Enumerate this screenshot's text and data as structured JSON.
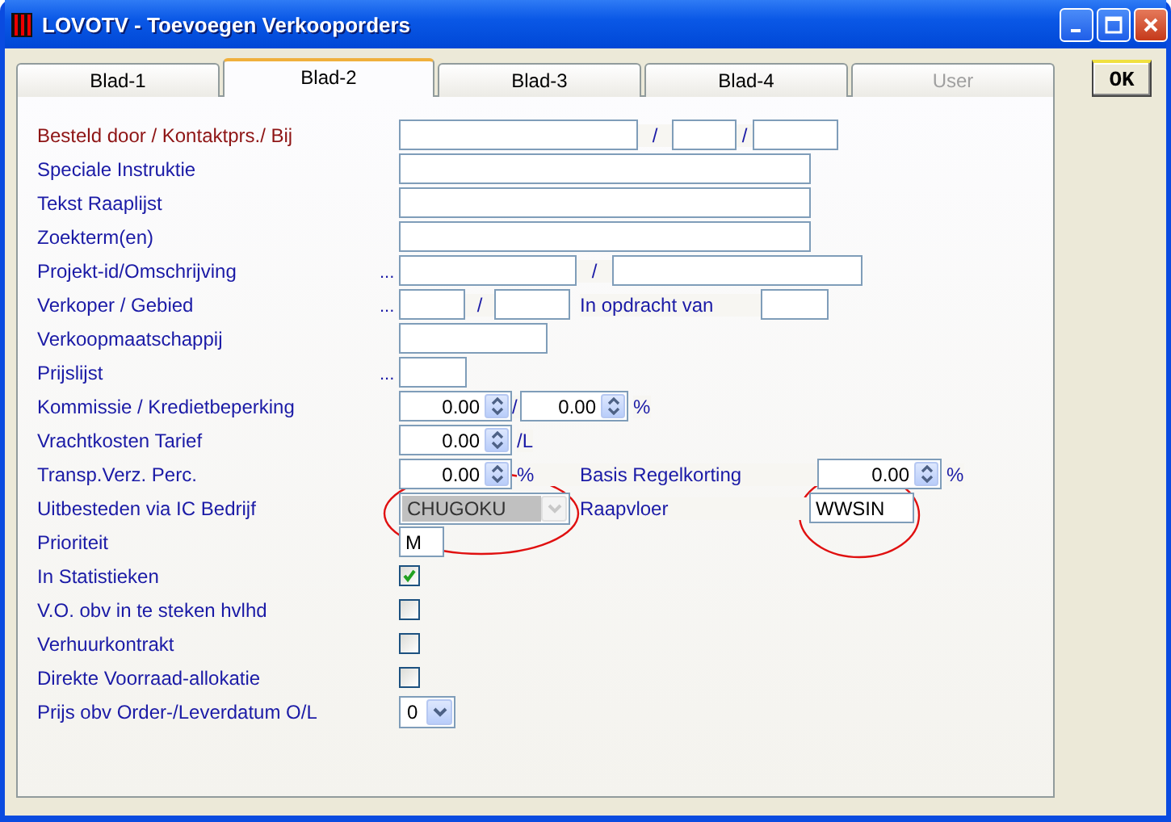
{
  "window": {
    "title": "LOVOTV - Toevoegen Verkooporders"
  },
  "tabs": [
    {
      "label": "Blad-1",
      "selected": false,
      "disabled": false
    },
    {
      "label": "Blad-2",
      "selected": true,
      "disabled": false
    },
    {
      "label": "Blad-3",
      "selected": false,
      "disabled": false
    },
    {
      "label": "Blad-4",
      "selected": false,
      "disabled": false
    },
    {
      "label": "User",
      "selected": false,
      "disabled": true
    }
  ],
  "ok_button": {
    "label": "OK"
  },
  "rows": [
    {
      "label": "Besteld door / Kontaktprs./ Bij",
      "required": true,
      "parts": [
        {
          "kind": "input"
        },
        {
          "kind": "text",
          "text": "/"
        },
        {
          "kind": "input"
        },
        {
          "kind": "text",
          "text": "/"
        },
        {
          "kind": "input"
        }
      ]
    },
    {
      "label": "Speciale Instruktie",
      "required": false,
      "parts": [
        {
          "kind": "input"
        }
      ]
    },
    {
      "label": "Tekst Raaplijst",
      "required": false,
      "parts": [
        {
          "kind": "input"
        }
      ]
    },
    {
      "label": "Zoekterm(en)",
      "required": false,
      "parts": [
        {
          "kind": "input"
        }
      ]
    },
    {
      "label": "Projekt-id/Omschrijving",
      "required": false,
      "lookup": "...",
      "parts": [
        {
          "kind": "input"
        },
        {
          "kind": "text",
          "text": "/"
        },
        {
          "kind": "input"
        }
      ]
    },
    {
      "label": "Verkoper / Gebied",
      "required": false,
      "lookup": "...",
      "parts": [
        {
          "kind": "input"
        },
        {
          "kind": "text",
          "text": "/"
        },
        {
          "kind": "input"
        },
        {
          "kind": "label",
          "text": "In opdracht van"
        },
        {
          "kind": "input"
        }
      ]
    },
    {
      "label": "Verkoopmaatschappij",
      "required": false,
      "parts": [
        {
          "kind": "input"
        }
      ]
    },
    {
      "label": "Prijslijst",
      "required": false,
      "lookup": "...",
      "parts": [
        {
          "kind": "input"
        }
      ]
    },
    {
      "label": "Kommissie / Kredietbeperking",
      "required": false,
      "parts": [
        {
          "kind": "spin",
          "value": "0.00"
        },
        {
          "kind": "text",
          "text": "/"
        },
        {
          "kind": "spin",
          "value": "0.00"
        },
        {
          "kind": "text",
          "text": "%"
        }
      ]
    },
    {
      "label": "Vrachtkosten Tarief",
      "required": false,
      "parts": [
        {
          "kind": "spin",
          "value": "0.00"
        },
        {
          "kind": "text",
          "text": "/L"
        }
      ]
    },
    {
      "label": "Transp.Verz. Perc.",
      "required": false,
      "parts": [
        {
          "kind": "spin",
          "value": "0.00"
        },
        {
          "kind": "text",
          "text": "%"
        },
        {
          "kind": "label",
          "text": "Basis Regelkorting"
        },
        {
          "kind": "spin",
          "value": "0.00"
        },
        {
          "kind": "text",
          "text": "%"
        }
      ]
    },
    {
      "label": "Uitbesteden via IC Bedrijf",
      "required": false,
      "parts": [
        {
          "kind": "select",
          "value": "CHUGOKU",
          "disabled": true
        },
        {
          "kind": "label",
          "text": "Raapvloer"
        },
        {
          "kind": "input",
          "value": "WWSIN"
        }
      ]
    },
    {
      "label": "Prioriteit",
      "required": false,
      "parts": [
        {
          "kind": "input",
          "value": "M"
        }
      ]
    },
    {
      "label": "In Statistieken",
      "required": false,
      "parts": [
        {
          "kind": "checkbox",
          "checked": true
        }
      ]
    },
    {
      "label": "V.O. obv in te steken hvlhd",
      "required": false,
      "parts": [
        {
          "kind": "checkbox",
          "checked": false
        }
      ]
    },
    {
      "label": "Verhuurkontrakt",
      "required": false,
      "parts": [
        {
          "kind": "checkbox",
          "checked": false
        }
      ]
    },
    {
      "label": "Direkte Voorraad-allokatie",
      "required": false,
      "parts": [
        {
          "kind": "checkbox",
          "checked": false
        }
      ]
    },
    {
      "label": "Prijs obv Order-/Leverdatum O/L",
      "required": false,
      "parts": [
        {
          "kind": "select",
          "value": "0",
          "disabled": false
        }
      ]
    }
  ],
  "annotations": [
    {
      "kind": "ellipse"
    },
    {
      "kind": "ellipse"
    }
  ]
}
